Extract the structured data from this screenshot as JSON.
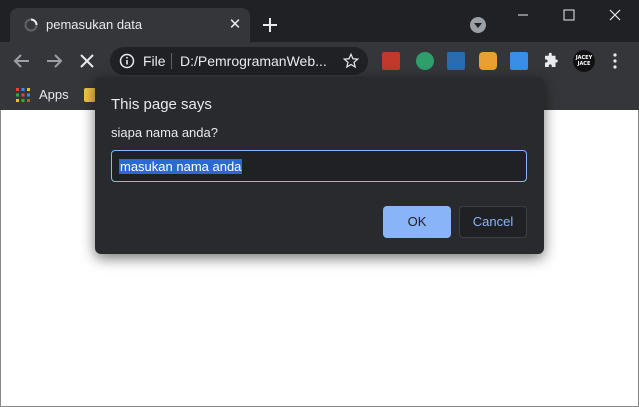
{
  "tab": {
    "title": "pemasukan data"
  },
  "omnibox": {
    "scheme_label": "File",
    "url": "D:/PemrogramanWeb..."
  },
  "avatar": {
    "line1": "JACEY",
    "line2": "JACE"
  },
  "bookmarks": {
    "apps_label": "Apps"
  },
  "dialog": {
    "title": "This page says",
    "message": "siapa nama anda?",
    "input_value": "masukan nama anda",
    "ok_label": "OK",
    "cancel_label": "Cancel"
  },
  "colors": {
    "accent": "#8ab4f8",
    "selection": "#2a6ad2",
    "chrome_dark": "#202124",
    "toolbar": "#35363a"
  }
}
